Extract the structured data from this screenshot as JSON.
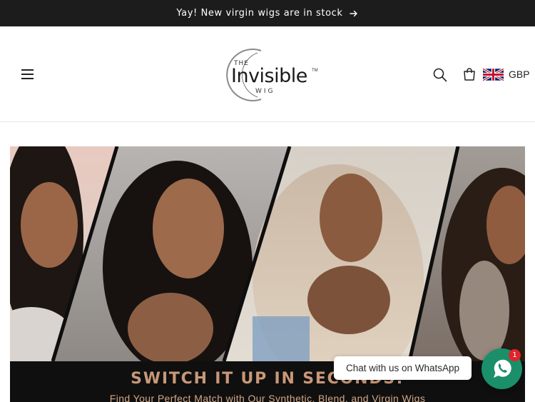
{
  "announcement": {
    "text": "Yay! New virgin wigs are in stock",
    "arrow_icon": "arrow-right-icon"
  },
  "header": {
    "menu_icon": "hamburger-menu-icon",
    "logo": {
      "the": "THE",
      "name": "Invisible",
      "tm": "TM",
      "wig": "WIG"
    },
    "search_icon": "search-icon",
    "cart_icon": "cart-icon",
    "currency": {
      "flag_icon": "uk-flag-icon",
      "code": "GBP"
    }
  },
  "hero": {
    "title": "SWITCH IT UP IN SECONDS!",
    "subtitle": "Find Your Perfect Match with Our Synthetic, Blend, and Virgin Wigs",
    "colors": {
      "banner_bg": "#0f0f0f",
      "title": "#c99877"
    }
  },
  "whatsapp": {
    "chat_label": "Chat with us on WhatsApp",
    "badge_count": "1",
    "icon": "whatsapp-icon",
    "color": "#1a8f6a"
  }
}
